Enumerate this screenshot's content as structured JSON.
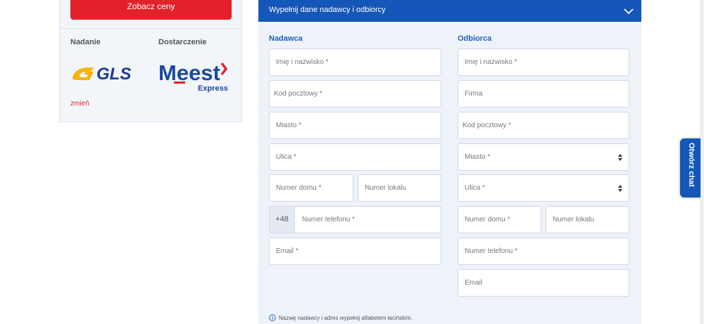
{
  "summary": {
    "price_button": "Zobacz ceny",
    "pickup_label": "Nadanie",
    "delivery_label": "Dostarczenie",
    "pickup_carrier": "GLS",
    "delivery_carrier_name": "Meest",
    "delivery_carrier_sub": "Express",
    "change_link": "zmień"
  },
  "form": {
    "header": "Wypełnij dane nadawcy i odbiorcy",
    "sender": {
      "label": "Nadawca",
      "name": "Imię i nazwisko *",
      "postal": "Kod pocztowy *",
      "city": "Miasto *",
      "street": "Ulica *",
      "house": "Numer domu *",
      "flat": "Numer lokalu",
      "phone_prefix": "+48",
      "phone": "Numer telefonu *",
      "email": "Email *"
    },
    "recipient": {
      "label": "Odbiorca",
      "name": "Imię i nazwisko *",
      "company": "Firma",
      "postal": "Kod pocztowy *",
      "city": "Miasto *",
      "street": "Ulica *",
      "house": "Numer domu *",
      "flat": "Numer lokalu",
      "phone": "Numer telefonu *",
      "email": "Email"
    },
    "note": "Nazwę nadawcy i adres wypełnij alfabetem łacińskim."
  },
  "chat": {
    "label": "Otwórz chat"
  },
  "colors": {
    "brand_blue": "#1457b8",
    "brand_red": "#e3212b",
    "gls_yellow": "#f5b50a",
    "gls_blue": "#1b3d8f"
  },
  "icons": [
    "chevron-down-icon",
    "select-arrows-icon",
    "info-icon"
  ]
}
